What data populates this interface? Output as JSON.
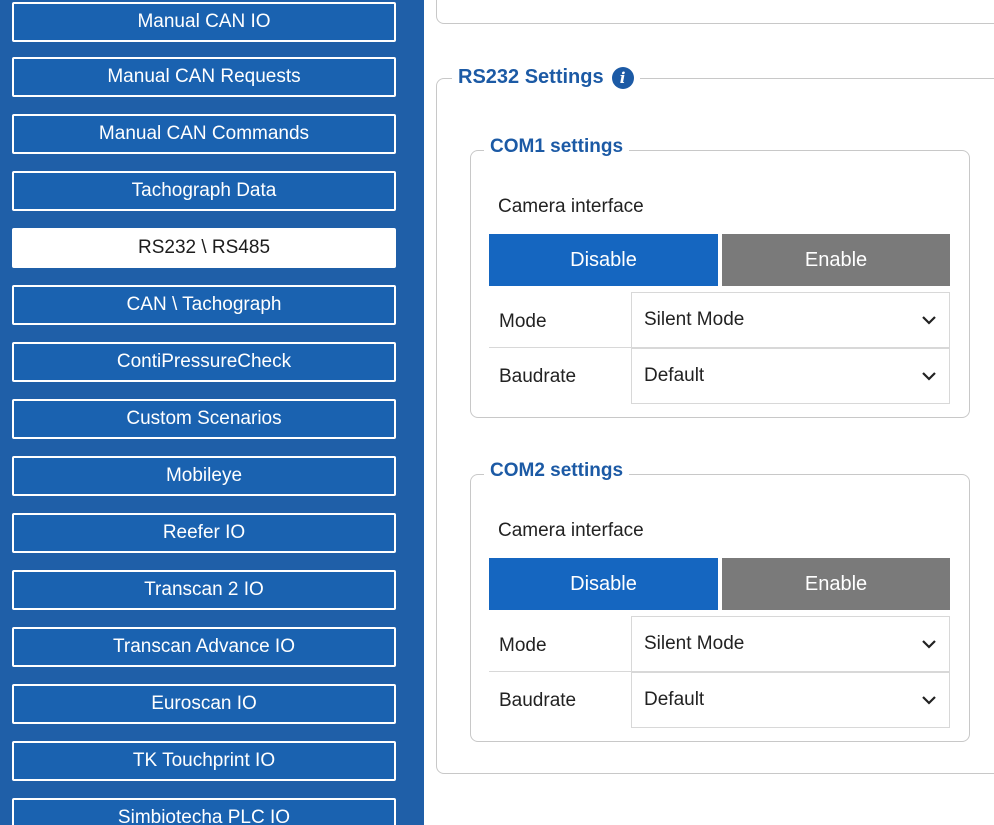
{
  "sidebar": {
    "items": [
      {
        "label": "Manual CAN IO",
        "active": false
      },
      {
        "label": "Manual CAN Requests",
        "active": false
      },
      {
        "label": "Manual CAN Commands",
        "active": false
      },
      {
        "label": "Tachograph Data",
        "active": false
      },
      {
        "label": "RS232 \\ RS485",
        "active": true
      },
      {
        "label": "CAN \\ Tachograph",
        "active": false
      },
      {
        "label": "ContiPressureCheck",
        "active": false
      },
      {
        "label": "Custom Scenarios",
        "active": false
      },
      {
        "label": "Mobileye",
        "active": false
      },
      {
        "label": "Reefer IO",
        "active": false
      },
      {
        "label": "Transcan 2 IO",
        "active": false
      },
      {
        "label": "Transcan Advance IO",
        "active": false
      },
      {
        "label": "Euroscan IO",
        "active": false
      },
      {
        "label": "TK Touchprint IO",
        "active": false
      },
      {
        "label": "Simbiotecha PLC IO",
        "active": false
      }
    ]
  },
  "rs232": {
    "title": "RS232 Settings",
    "info_icon": "info-icon",
    "com1": {
      "title": "COM1 settings",
      "camera_label": "Camera interface",
      "disable_label": "Disable",
      "enable_label": "Enable",
      "selected": "Disable",
      "mode_label": "Mode",
      "mode_value": "Silent Mode",
      "baud_label": "Baudrate",
      "baud_value": "Default"
    },
    "com2": {
      "title": "COM2 settings",
      "camera_label": "Camera interface",
      "disable_label": "Disable",
      "enable_label": "Enable",
      "selected": "Disable",
      "mode_label": "Mode",
      "mode_value": "Silent Mode",
      "baud_label": "Baudrate",
      "baud_value": "Default"
    }
  },
  "colors": {
    "sidebar_bg": "#1f5fa8",
    "accent": "#1566c0",
    "disabled_toggle": "#7a7a7a",
    "heading": "#1c5aa5"
  }
}
